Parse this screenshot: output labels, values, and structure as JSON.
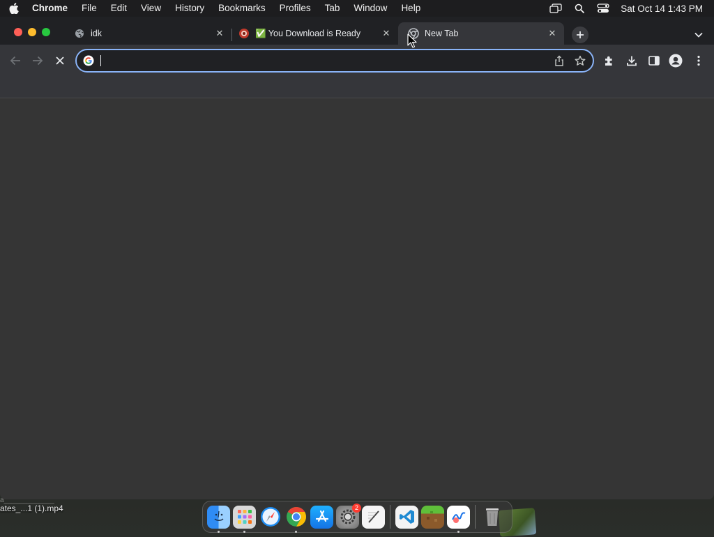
{
  "menubar": {
    "app_name": "Chrome",
    "items": [
      "File",
      "Edit",
      "View",
      "History",
      "Bookmarks",
      "Profiles",
      "Tab",
      "Window",
      "Help"
    ],
    "clock": "Sat Oct 14  1:43 PM"
  },
  "tabs": [
    {
      "title": "idk",
      "favicon": "globe-icon",
      "active": false
    },
    {
      "title": "✅ You Download is Ready",
      "favicon": "red-circle-favicon",
      "active": false
    },
    {
      "title": "New Tab",
      "favicon": "chrome-newtab-icon",
      "active": true
    }
  ],
  "omnibox": {
    "value": "",
    "placeholder": ""
  },
  "desktop": {
    "file_label": "ates_...1 (1).mp4"
  },
  "dock": {
    "apps": [
      {
        "name": "finder",
        "icon": "finder-icon",
        "running": true
      },
      {
        "name": "launchpad",
        "icon": "launchpad-icon",
        "running": true
      },
      {
        "name": "safari",
        "icon": "safari-icon",
        "running": false
      },
      {
        "name": "chrome",
        "icon": "chrome-icon",
        "running": true
      },
      {
        "name": "app-store",
        "icon": "app-store-icon",
        "running": false
      },
      {
        "name": "system-settings",
        "icon": "gear-icon",
        "running": false,
        "badge": "2"
      },
      {
        "name": "textedit",
        "icon": "pen-icon",
        "running": false
      },
      {
        "name": "vscode",
        "icon": "vscode-icon",
        "running": false
      },
      {
        "name": "minecraft",
        "icon": "grass-block-icon",
        "running": false
      },
      {
        "name": "freeform",
        "icon": "freeform-icon",
        "running": true
      },
      {
        "name": "trash",
        "icon": "trash-icon",
        "running": false
      }
    ]
  },
  "colors": {
    "accent": "#8ab4f8",
    "tabstrip": "#202124",
    "toolbar": "#35363a",
    "content": "#353535"
  }
}
